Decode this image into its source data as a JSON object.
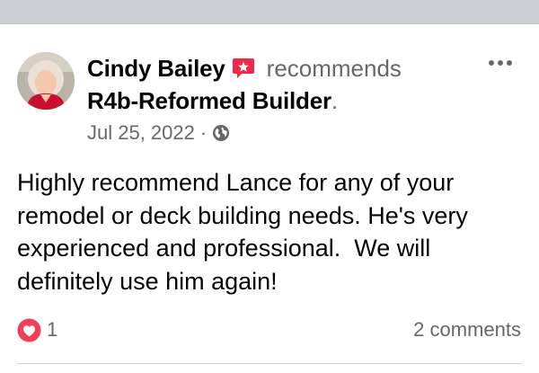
{
  "post": {
    "author": "Cindy Bailey",
    "verb": "recommends",
    "page_name": "R4b-Reformed Builder",
    "period": ".",
    "date": "Jul 25, 2022",
    "separator": "·",
    "privacy_icon": "globe-icon",
    "recommend_icon": "flag-icon",
    "text_lines": [
      "Highly recommend Lance for any of your",
      "remodel or deck building needs. He's very",
      "experienced and professional.  We will",
      "definitely use him again!"
    ]
  },
  "footer": {
    "reaction_icon": "love-icon",
    "reaction_count": "1",
    "comments_label": "2 comments"
  },
  "colors": {
    "secondary_text": "#65676b",
    "primary_text": "#050505",
    "recommend_badge": "#f02849",
    "love_reaction": "#f33e58",
    "separator_bar": "#c9ccd1"
  }
}
